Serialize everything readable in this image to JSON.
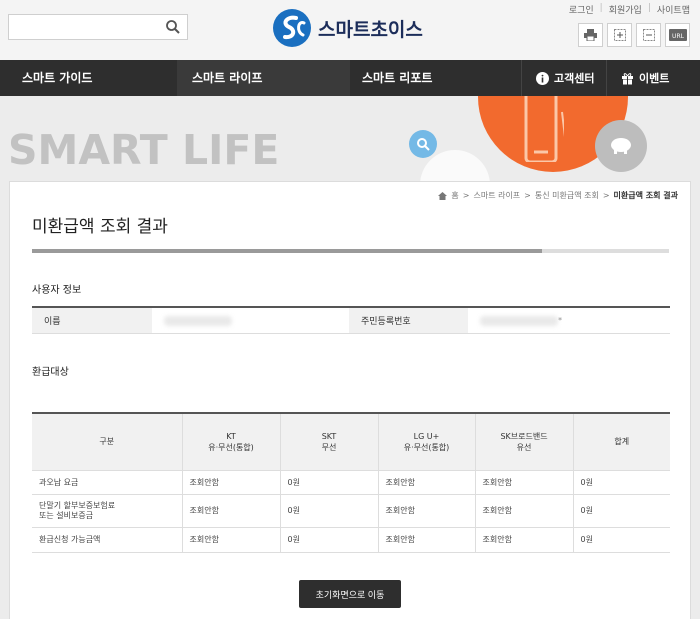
{
  "header": {
    "search_placeholder": "",
    "logo_text": "스마트초이스",
    "util_links": [
      "로그인",
      "회원가입",
      "사이트맵"
    ],
    "tools": [
      "print-icon",
      "zoom-in-icon",
      "zoom-out-icon",
      "url-icon"
    ],
    "url_label": "URL"
  },
  "nav": {
    "items": [
      "스마트 가이드",
      "스마트 라이프",
      "스마트 리포트"
    ],
    "customer_center": "고객센터",
    "event": "이벤트"
  },
  "hero": {
    "title": "SMART LIFE"
  },
  "breadcrumb": [
    "홈",
    "스마트 라이프",
    "통신 미환급액 조회",
    "미환급액 조회 결과"
  ],
  "page_title": "미환급액 조회 결과",
  "progress": {
    "value": 0.8
  },
  "user_section": {
    "title": "사용자 정보",
    "name_label": "이름",
    "id_label": "주민등록번호",
    "id_suffix": "*"
  },
  "refund_section": {
    "title": "환급대상",
    "headers": [
      [
        "구분"
      ],
      [
        "KT",
        "유·무선(통합)"
      ],
      [
        "SKT",
        "무선"
      ],
      [
        "LG U+",
        "유·무선(통합)"
      ],
      [
        "SK브로드밴드",
        "유선"
      ],
      [
        "합계"
      ]
    ],
    "rows": [
      {
        "label": [
          "과오납 요금"
        ],
        "cells": [
          "조회안함",
          "0원",
          "조회안함",
          "조회안함",
          "0원"
        ]
      },
      {
        "label": [
          "단말기 할부보증보험료",
          "또는 설비보증금"
        ],
        "cells": [
          "조회안함",
          "0원",
          "조회안함",
          "조회안함",
          "0원"
        ]
      },
      {
        "label": [
          "환급신청 가능금액"
        ],
        "cells": [
          "조회안함",
          "0원",
          "조회안함",
          "조회안함",
          "0원"
        ]
      }
    ]
  },
  "reset_button": "초기화면으로 이동",
  "colors": {
    "nav_bg": "#2e2e2e",
    "accent_orange": "#f26a2e",
    "logo_blue": "#1a6fc0"
  }
}
